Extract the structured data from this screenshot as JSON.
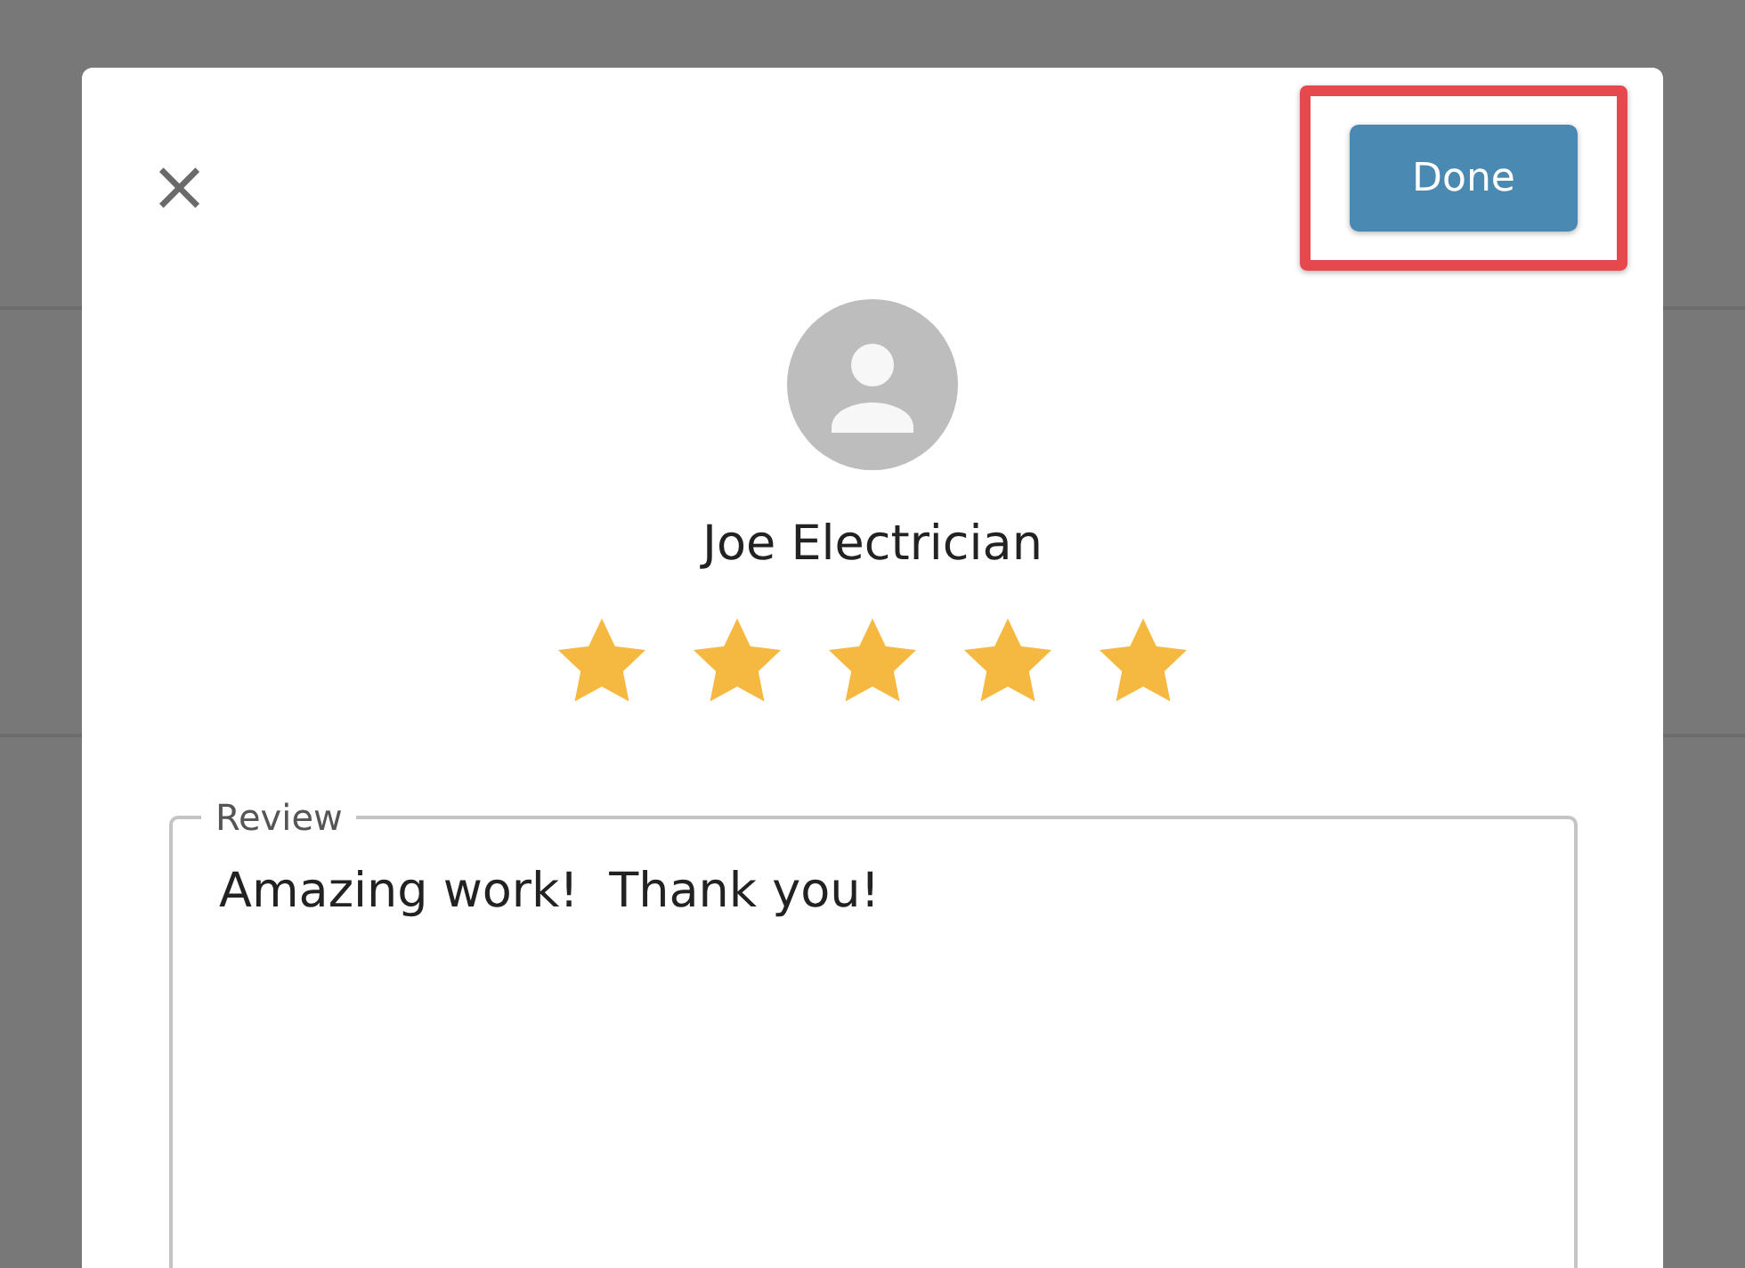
{
  "dialog": {
    "close_label": "×",
    "done_button": {
      "label": "Done",
      "highlighted": true
    },
    "reviewer": {
      "name": "Joe Electrician",
      "stars": 5
    },
    "review_field": {
      "label": "Review",
      "value": "Amazing work!  Thank you!"
    }
  }
}
